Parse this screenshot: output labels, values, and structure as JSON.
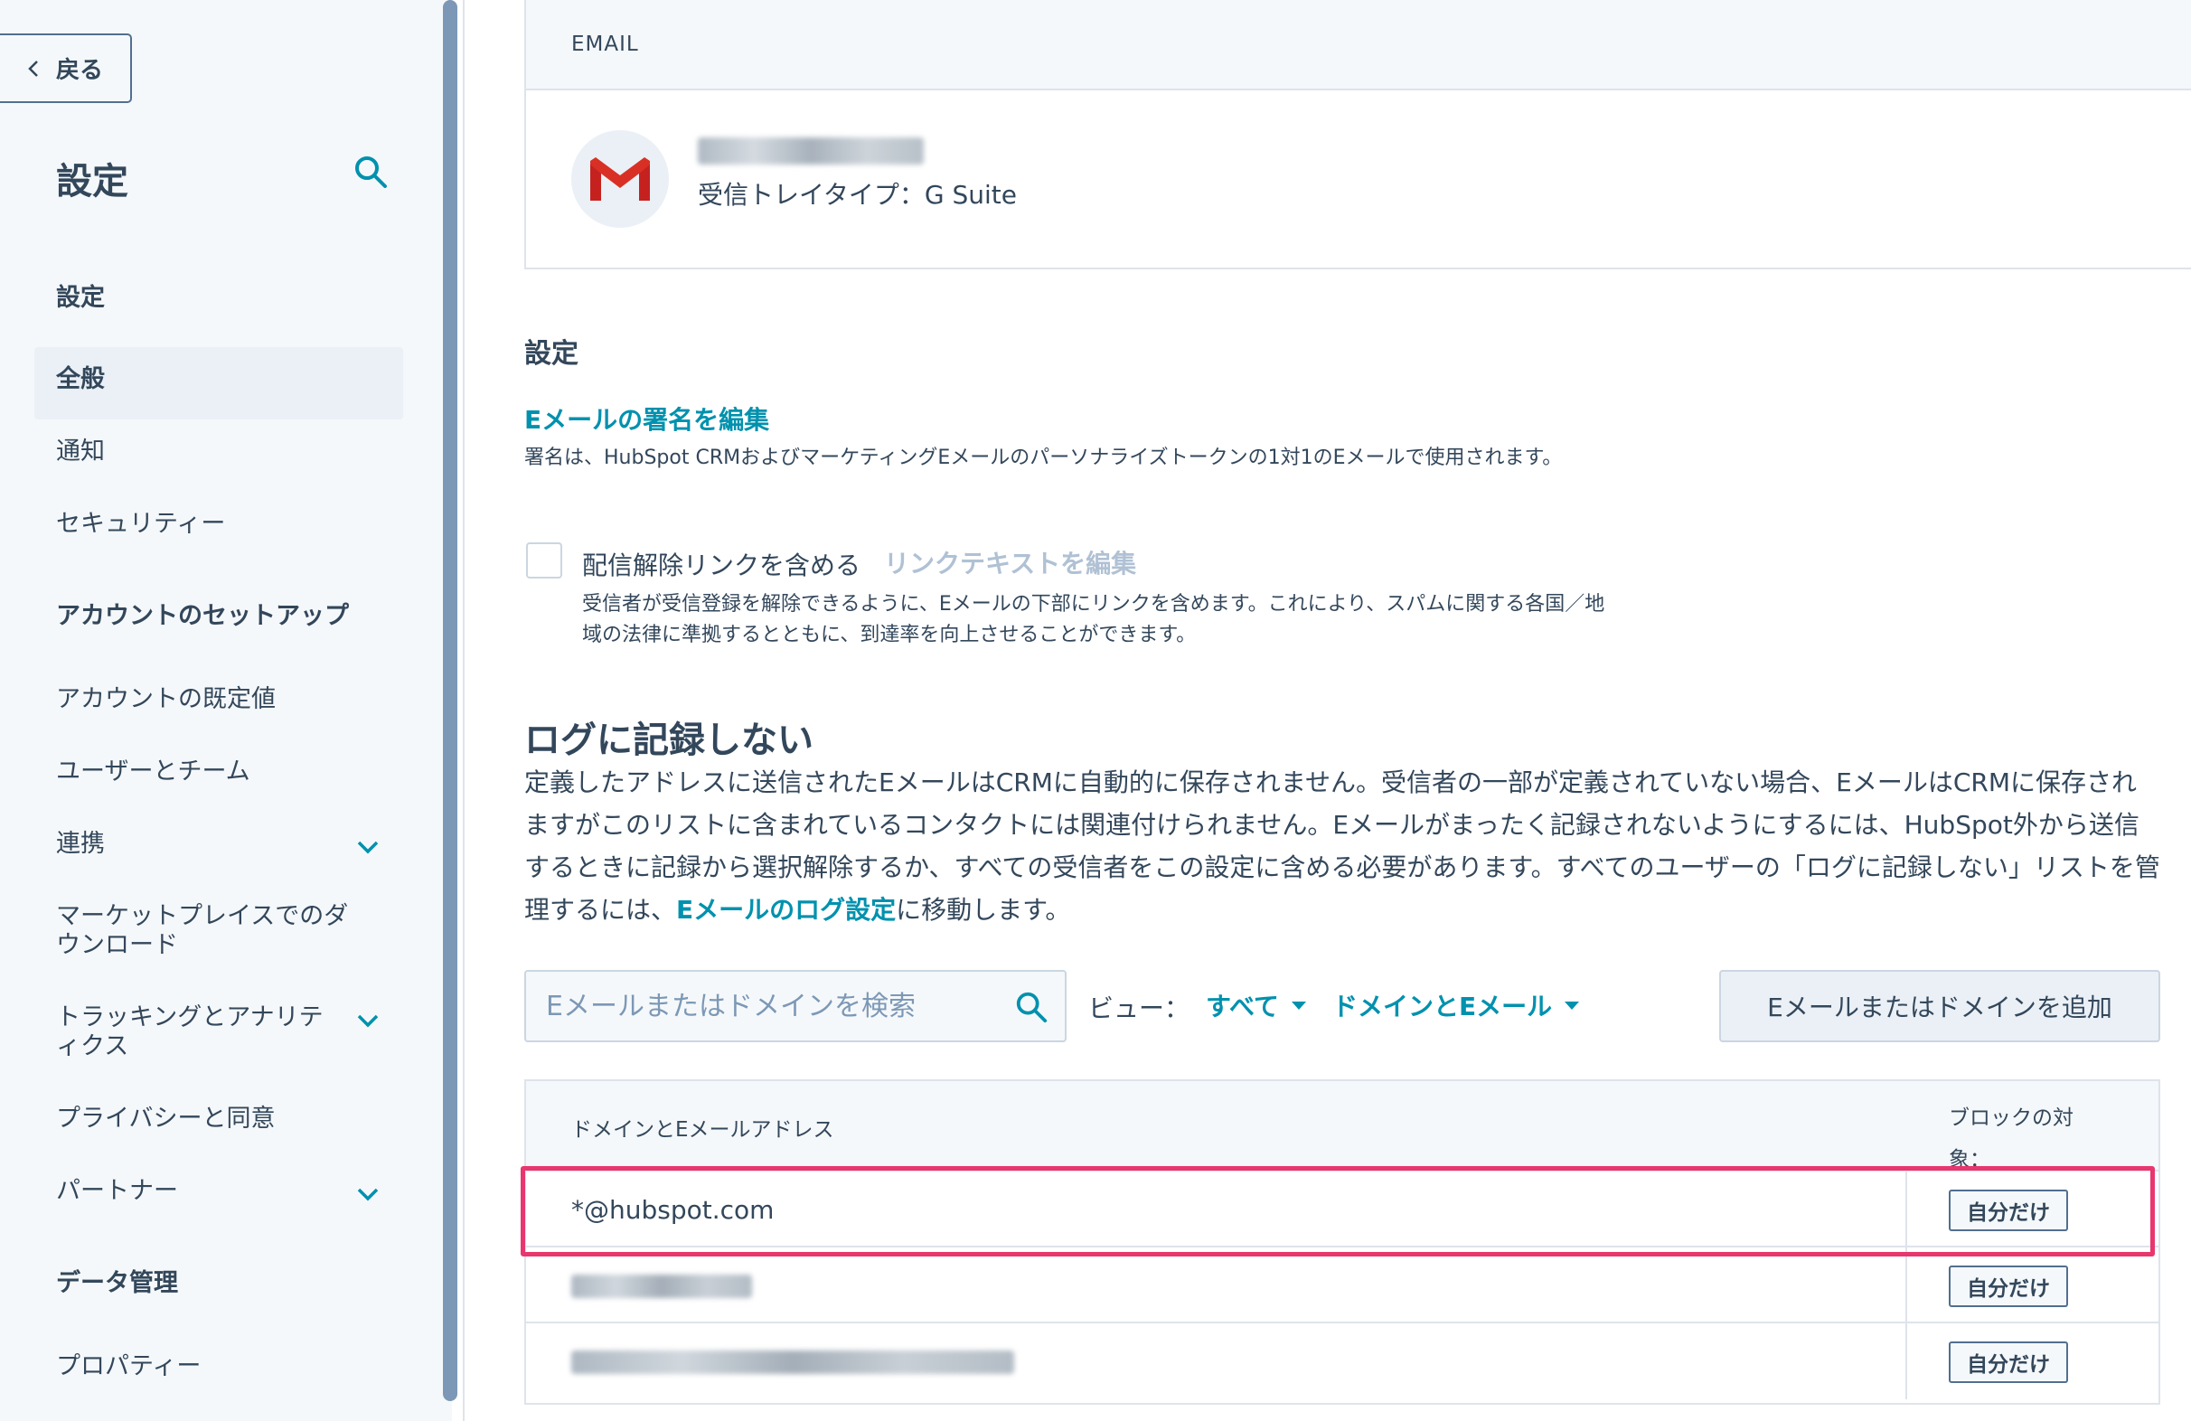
{
  "sidebar": {
    "back_label": "戻る",
    "title": "設定",
    "items": [
      {
        "label": "設定",
        "style": "bold"
      },
      {
        "label": "全般",
        "style": "active"
      },
      {
        "label": "通知"
      },
      {
        "label": "セキュリティー"
      },
      {
        "label": "アカウントのセットアップ",
        "style": "section"
      },
      {
        "label": "アカウントの既定値"
      },
      {
        "label": "ユーザーとチーム"
      },
      {
        "label": "連携",
        "expandable": true
      },
      {
        "label": "マーケットプレイスでのダウンロード"
      },
      {
        "label": "トラッキングとアナリティクス",
        "expandable": true
      },
      {
        "label": "プライバシーと同意"
      },
      {
        "label": "パートナー",
        "expandable": true
      },
      {
        "label": "データ管理",
        "style": "section"
      },
      {
        "label": "プロパティー"
      }
    ]
  },
  "email_card": {
    "header": "EMAIL",
    "provider_icon": "gmail-icon",
    "inbox_type": "受信トレイタイプ：G Suite"
  },
  "settings": {
    "heading": "設定",
    "signature_link": "Eメールの署名を編集",
    "signature_desc": "署名は、HubSpot CRMおよびマーケティングEメールのパーソナライズトークンの1対1のEメールで使用されます。",
    "unsubscribe_label": "配信解除リンクを含める",
    "unsubscribe_edit_link": "リンクテキストを編集",
    "unsubscribe_desc": "受信者が受信登録を解除できるように、Eメールの下部にリンクを含めます。これにより、スパムに関する各国／地域の法律に準拠するとともに、到達率を向上させることができます。"
  },
  "no_log": {
    "heading": "ログに記録しない",
    "desc_before": "定義したアドレスに送信されたEメールはCRMに自動的に保存されません。受信者の一部が定義されていない場合、EメールはCRMに保存されますがこのリストに含まれているコンタクトには関連付けられません。Eメールがまったく記録されないようにするには、HubSpot外から送信するときに記録から選択解除するか、すべての受信者をこの設定に含める必要があります。すべてのユーザーの「ログに記録しない」リストを管理するには、",
    "desc_link": "Eメールのログ設定",
    "desc_after": "に移動します。",
    "search_placeholder": "Eメールまたはドメインを検索",
    "view_label": "ビュー：",
    "view_filter_1": "すべて",
    "view_filter_2": "ドメインとEメール",
    "add_button": "Eメールまたはドメインを追加",
    "table": {
      "col_domain": "ドメインとEメールアドレス",
      "col_block": "ブロックの対象：",
      "rows": [
        {
          "value": "*@hubspot.com",
          "scope": "自分だけ",
          "highlighted": true
        },
        {
          "value": "",
          "scope": "自分だけ",
          "redacted": true
        },
        {
          "value": "",
          "scope": "自分だけ",
          "redacted": true
        }
      ]
    }
  },
  "colors": {
    "accent": "#0091ae",
    "highlight": "#e8366f",
    "text": "#33475b"
  }
}
